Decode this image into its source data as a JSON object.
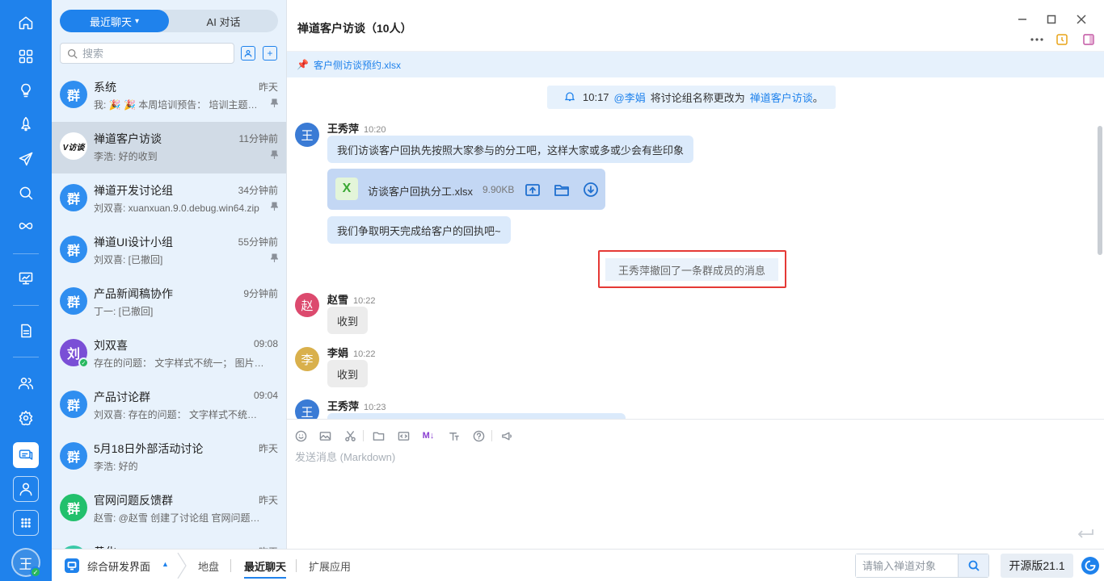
{
  "colors": {
    "brand": "#1f82ec",
    "highlight": "#e53935",
    "online": "#27b85f"
  },
  "rail": {
    "icons": [
      "home-icon",
      "apps-grid-icon",
      "lightbulb-icon",
      "rocket-icon",
      "paper-plane-icon",
      "search-zoom-icon",
      "infinity-icon",
      "presentation-icon",
      "document-icon",
      "team-icon",
      "settings-icon",
      "chat-icon",
      "user-icon",
      "more-dots-icon"
    ],
    "avatar": "王"
  },
  "panel": {
    "tabs": [
      {
        "label": "最近聊天"
      },
      {
        "label": "AI 对话"
      }
    ],
    "search_placeholder": "搜索",
    "conversations": [
      {
        "avatar": "群",
        "color": "#2f8ef0",
        "name": "系统",
        "time": "昨天",
        "preview": "我: 🎉 🎉 本周培训预告： 培训主题： 禅道...",
        "pinned": true
      },
      {
        "avatar": "V访谈",
        "color": "#ffffff",
        "name": "禅道客户访谈",
        "time": "11分钟前",
        "preview": "李浩: 好的收到",
        "pinned": true,
        "active": true
      },
      {
        "avatar": "群",
        "color": "#2f8ef0",
        "name": "禅道开发讨论组",
        "time": "34分钟前",
        "preview": "刘双喜: xuanxuan.9.0.debug.win64.zip",
        "pinned": true
      },
      {
        "avatar": "群",
        "color": "#2f8ef0",
        "name": "禅道UI设计小组",
        "time": "55分钟前",
        "preview": "刘双喜: [已撤回]",
        "pinned": true
      },
      {
        "avatar": "群",
        "color": "#2f8ef0",
        "name": "产品新闻稿协作",
        "time": "9分钟前",
        "preview": "丁一: [已撤回]",
        "pinned": false
      },
      {
        "avatar": "刘",
        "color": "#7a4fd6",
        "name": "刘双喜",
        "time": "09:08",
        "preview": "存在的问题： 文字样式不统一； 图片大小不统一",
        "pinned": false,
        "online": true
      },
      {
        "avatar": "群",
        "color": "#2f8ef0",
        "name": "产品讨论群",
        "time": "09:04",
        "preview": "刘双喜: 存在的问题： 文字样式不统一； 图片大小不统一",
        "pinned": false
      },
      {
        "avatar": "群",
        "color": "#2f8ef0",
        "name": "5月18日外部活动讨论",
        "time": "昨天",
        "preview": "李浩: 好的",
        "pinned": false
      },
      {
        "avatar": "群",
        "color": "#22c06c",
        "name": "官网问题反馈群",
        "time": "昨天",
        "preview": "赵雪: @赵雪 创建了讨论组 官网问题反馈群",
        "pinned": false
      },
      {
        "avatar": "群",
        "color": "#3cc9a8",
        "name": "黄化",
        "time": "昨天",
        "preview": "",
        "pinned": false
      }
    ]
  },
  "chat": {
    "title": "禅道客户访谈（10人）",
    "pinned_file": "客户侧访谈预约.xlsx",
    "notice": {
      "time": "10:17",
      "actor": "@李娟",
      "action": "将讨论组名称更改为",
      "target": "禅道客户访谈",
      "end": "。"
    },
    "messages": {
      "m1": {
        "avatar": "王",
        "name": "王秀萍",
        "time": "10:20",
        "text1": "我们访谈客户回执先按照大家参与的分工吧，这样大家或多或少会有些印象",
        "file_name": "访谈客户回执分工.xlsx",
        "file_size": "9.90KB",
        "text2": "我们争取明天完成给客户的回执吧~"
      },
      "recall": "王秀萍撤回了一条群成员的消息",
      "m2": {
        "avatar": "赵",
        "name": "赵雪",
        "time": "10:22",
        "text": "收到"
      },
      "m3": {
        "avatar": "李",
        "name": "李娟",
        "time": "10:22",
        "text": "收到"
      },
      "m4": {
        "avatar": "王",
        "name": "王秀萍",
        "time": "10:23"
      }
    },
    "composer_placeholder": "发送消息 (Markdown)"
  },
  "bottombar": {
    "app_label": "综合研发界面",
    "tabs": [
      {
        "label": "地盘"
      },
      {
        "label": "最近聊天"
      },
      {
        "label": "扩展应用"
      }
    ],
    "search_placeholder": "请输入禅道对象",
    "version": "开源版21.1"
  }
}
